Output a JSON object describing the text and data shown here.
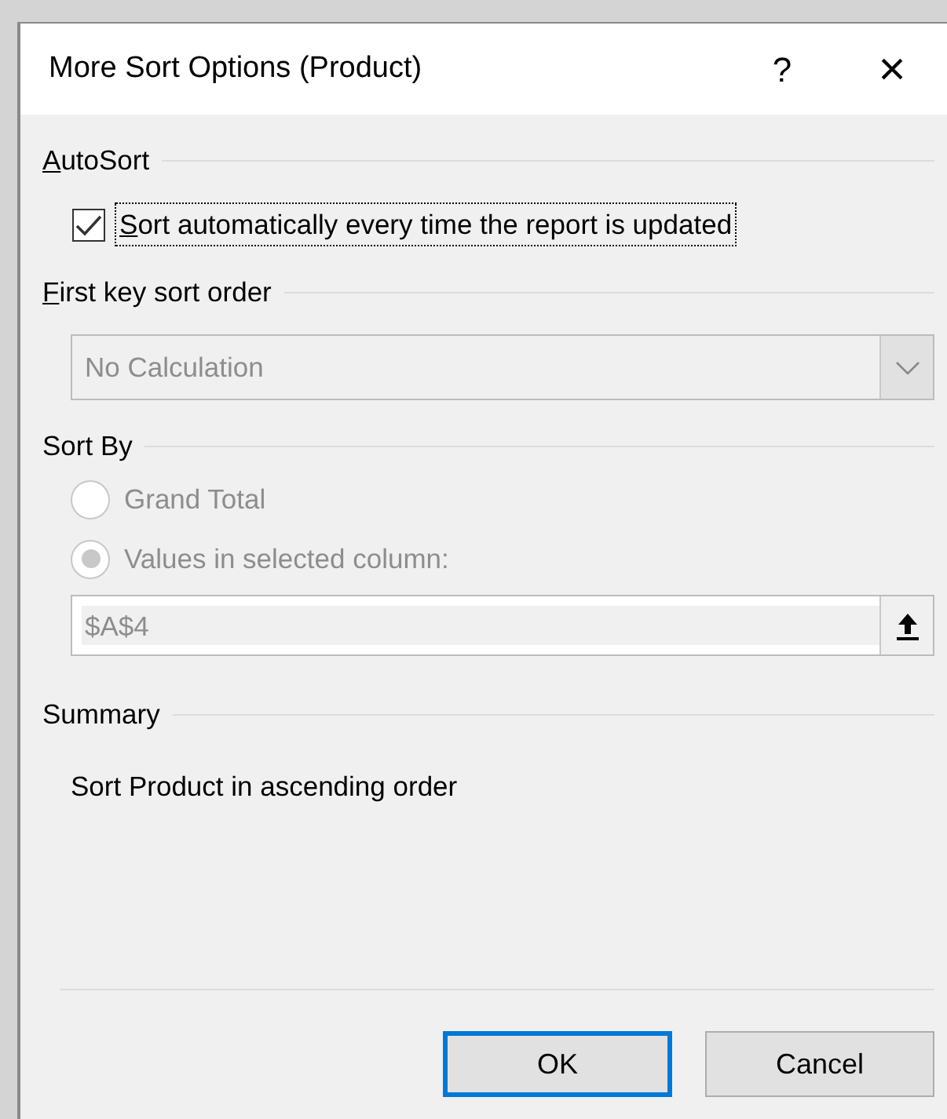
{
  "window": {
    "title": "More Sort Options (Product)",
    "help_button": "?",
    "close_button": "×"
  },
  "autosort": {
    "heading": "AutoSort",
    "mnemonic": true,
    "checkbox": {
      "label": "Sort automatically every time the report is updated",
      "mnemonic": true,
      "checked": true,
      "focused": true
    }
  },
  "first_key": {
    "heading": "First key sort order",
    "mnemonic": true,
    "dropdown": {
      "value": "No Calculation",
      "disabled": true
    }
  },
  "sort_by": {
    "heading": "Sort By",
    "mnemonic": false,
    "options": [
      {
        "label": "Grand Total",
        "selected": false,
        "disabled": true
      },
      {
        "label": "Values in selected column:",
        "selected": true,
        "disabled": true
      }
    ],
    "reference": {
      "value": "$A$4",
      "disabled": true
    }
  },
  "summary": {
    "heading": "Summary",
    "mnemonic": false,
    "text": "Sort Product in ascending order"
  },
  "buttons": [
    {
      "label": "OK",
      "default": true
    },
    {
      "label": "Cancel",
      "default": false
    }
  ]
}
